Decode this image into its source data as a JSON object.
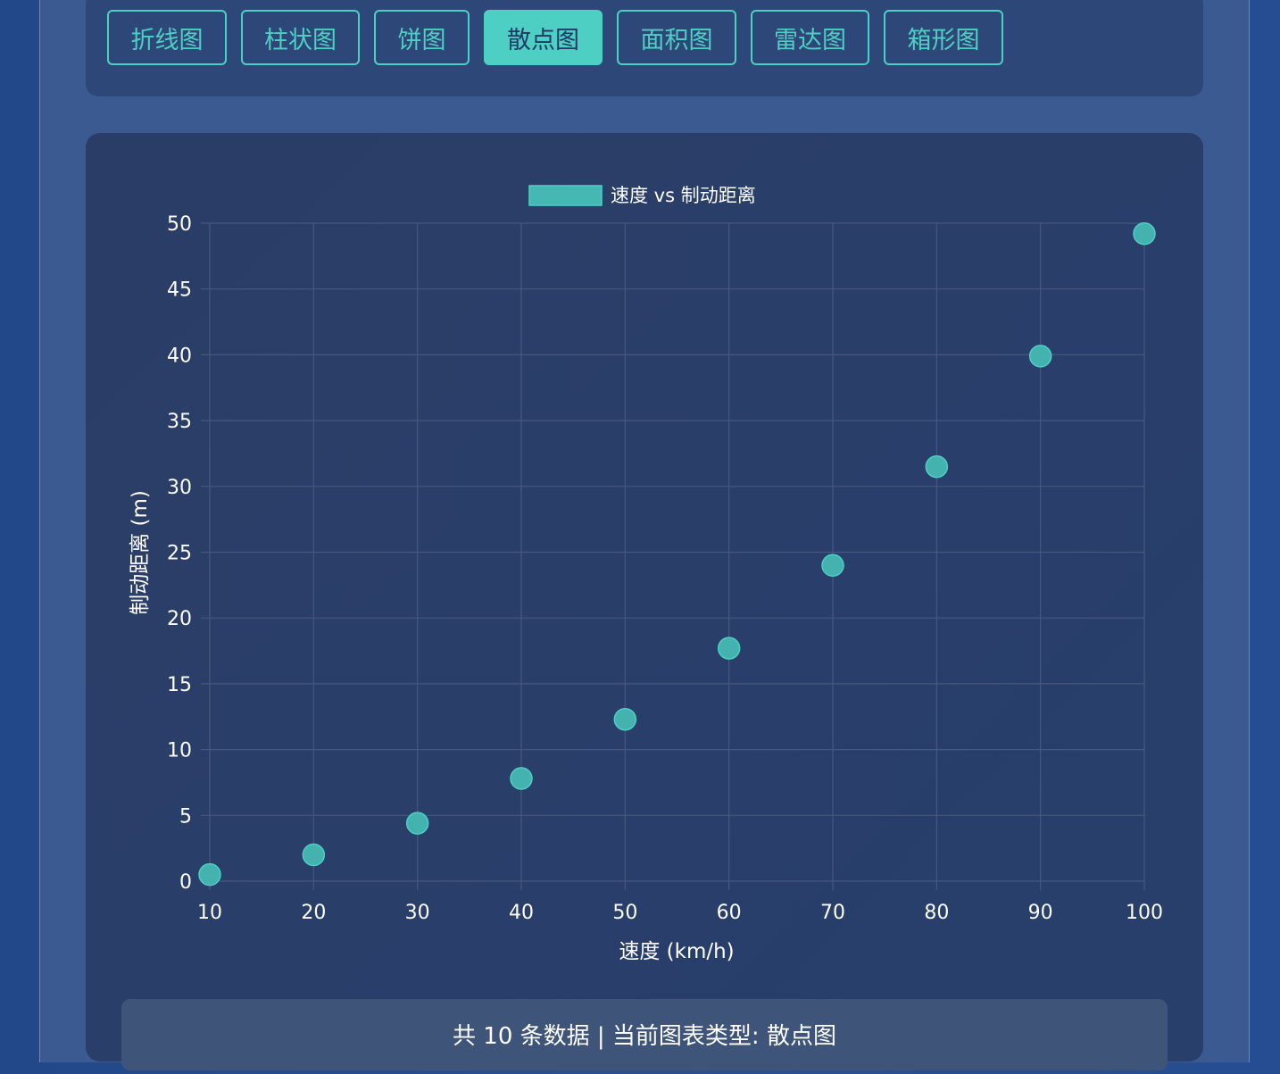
{
  "tabs": [
    {
      "label": "折线图",
      "active": false
    },
    {
      "label": "柱状图",
      "active": false
    },
    {
      "label": "饼图",
      "active": false
    },
    {
      "label": "散点图",
      "active": true
    },
    {
      "label": "面积图",
      "active": false
    },
    {
      "label": "雷达图",
      "active": false
    },
    {
      "label": "箱形图",
      "active": false
    }
  ],
  "colors": {
    "accent": "#4ecfc4",
    "point_fill": "#46b8b3",
    "grid": "#45597f",
    "text": "#ffffff"
  },
  "chart_data": {
    "type": "scatter",
    "title": "",
    "xlabel": "速度 (km/h)",
    "ylabel": "制动距离 (m)",
    "xlim": [
      10,
      100
    ],
    "ylim": [
      0,
      50
    ],
    "xticks": [
      10,
      20,
      30,
      40,
      50,
      60,
      70,
      80,
      90,
      100
    ],
    "yticks": [
      0,
      5,
      10,
      15,
      20,
      25,
      30,
      35,
      40,
      45,
      50
    ],
    "grid": true,
    "legend_position": "top-center",
    "series": [
      {
        "name": "速度 vs 制动距离",
        "color": "#46b8b3",
        "points": [
          {
            "x": 10,
            "y": 0.5
          },
          {
            "x": 20,
            "y": 2.0
          },
          {
            "x": 30,
            "y": 4.4
          },
          {
            "x": 40,
            "y": 7.8
          },
          {
            "x": 50,
            "y": 12.3
          },
          {
            "x": 60,
            "y": 17.7
          },
          {
            "x": 70,
            "y": 24.0
          },
          {
            "x": 80,
            "y": 31.5
          },
          {
            "x": 90,
            "y": 39.9
          },
          {
            "x": 100,
            "y": 49.2
          }
        ]
      }
    ]
  },
  "footer": {
    "text": "共 10 条数据 | 当前图表类型: 散点图"
  }
}
